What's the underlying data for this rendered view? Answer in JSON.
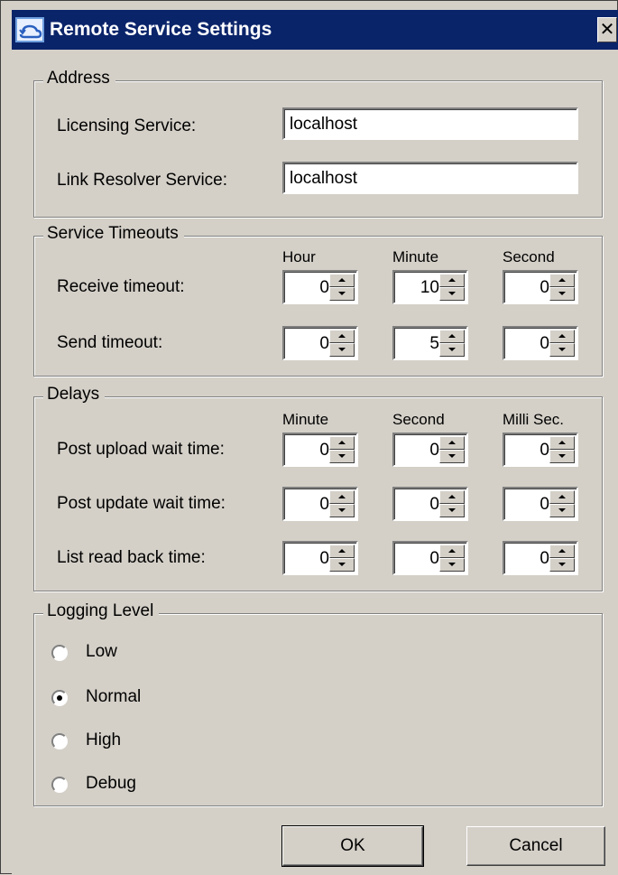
{
  "window": {
    "title": "Remote Service Settings",
    "close_glyph": "✕",
    "icon": "remote-service-icon",
    "title_bar_color": "#0a246a"
  },
  "address": {
    "legend": "Address",
    "licensing_label": "Licensing Service:",
    "licensing_value": "localhost",
    "link_resolver_label": "Link Resolver Service:",
    "link_resolver_value": "localhost"
  },
  "timeouts": {
    "legend": "Service Timeouts",
    "headers": [
      "Hour",
      "Minute",
      "Second"
    ],
    "rows": [
      {
        "label": "Receive timeout:",
        "values": [
          "0",
          "10",
          "0"
        ]
      },
      {
        "label": "Send timeout:",
        "values": [
          "0",
          "5",
          "0"
        ]
      }
    ]
  },
  "delays": {
    "legend": "Delays",
    "headers": [
      "Minute",
      "Second",
      "Milli Sec."
    ],
    "rows": [
      {
        "label": "Post upload wait time:",
        "values": [
          "0",
          "0",
          "0"
        ]
      },
      {
        "label": "Post update wait time:",
        "values": [
          "0",
          "0",
          "0"
        ]
      },
      {
        "label": "List read back time:",
        "values": [
          "0",
          "0",
          "0"
        ]
      }
    ]
  },
  "logging": {
    "legend": "Logging Level",
    "options": [
      "Low",
      "Normal",
      "High",
      "Debug"
    ],
    "selected": "Normal"
  },
  "buttons": {
    "ok": "OK",
    "cancel": "Cancel"
  }
}
